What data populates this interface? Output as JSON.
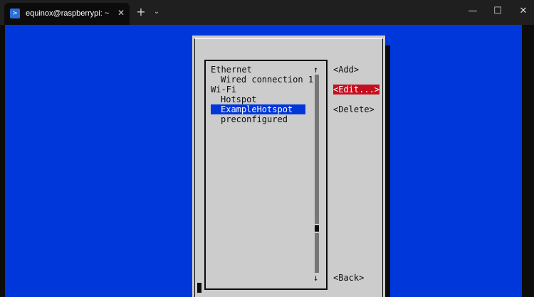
{
  "window": {
    "tab_title": "equinox@raspberrypi: ~",
    "tab_icon": "powershell-icon",
    "close_tab": "✕",
    "new_tab": "+",
    "dropdown": "⌄",
    "minimize": "—",
    "maximize": "☐",
    "close": "✕"
  },
  "colors": {
    "tui_background": "#0037da",
    "dialog": "#cccccc",
    "selected": "#0037da",
    "active_button": "#c50f1f",
    "scrollbar": "#767676"
  },
  "connections": {
    "items": [
      {
        "label": "Ethernet",
        "kind": "group"
      },
      {
        "label": "Wired connection 1",
        "kind": "connection"
      },
      {
        "label": "Wi-Fi",
        "kind": "group"
      },
      {
        "label": "Hotspot",
        "kind": "connection"
      },
      {
        "label": "ExampleHotspot",
        "kind": "connection",
        "selected": true
      },
      {
        "label": "preconfigured",
        "kind": "connection"
      }
    ],
    "scroll_up": "↑",
    "scroll_down": "↓"
  },
  "buttons": {
    "add": "<Add>",
    "edit": "<Edit...>",
    "delete": "<Delete>",
    "back": "<Back>",
    "focused": "edit"
  }
}
